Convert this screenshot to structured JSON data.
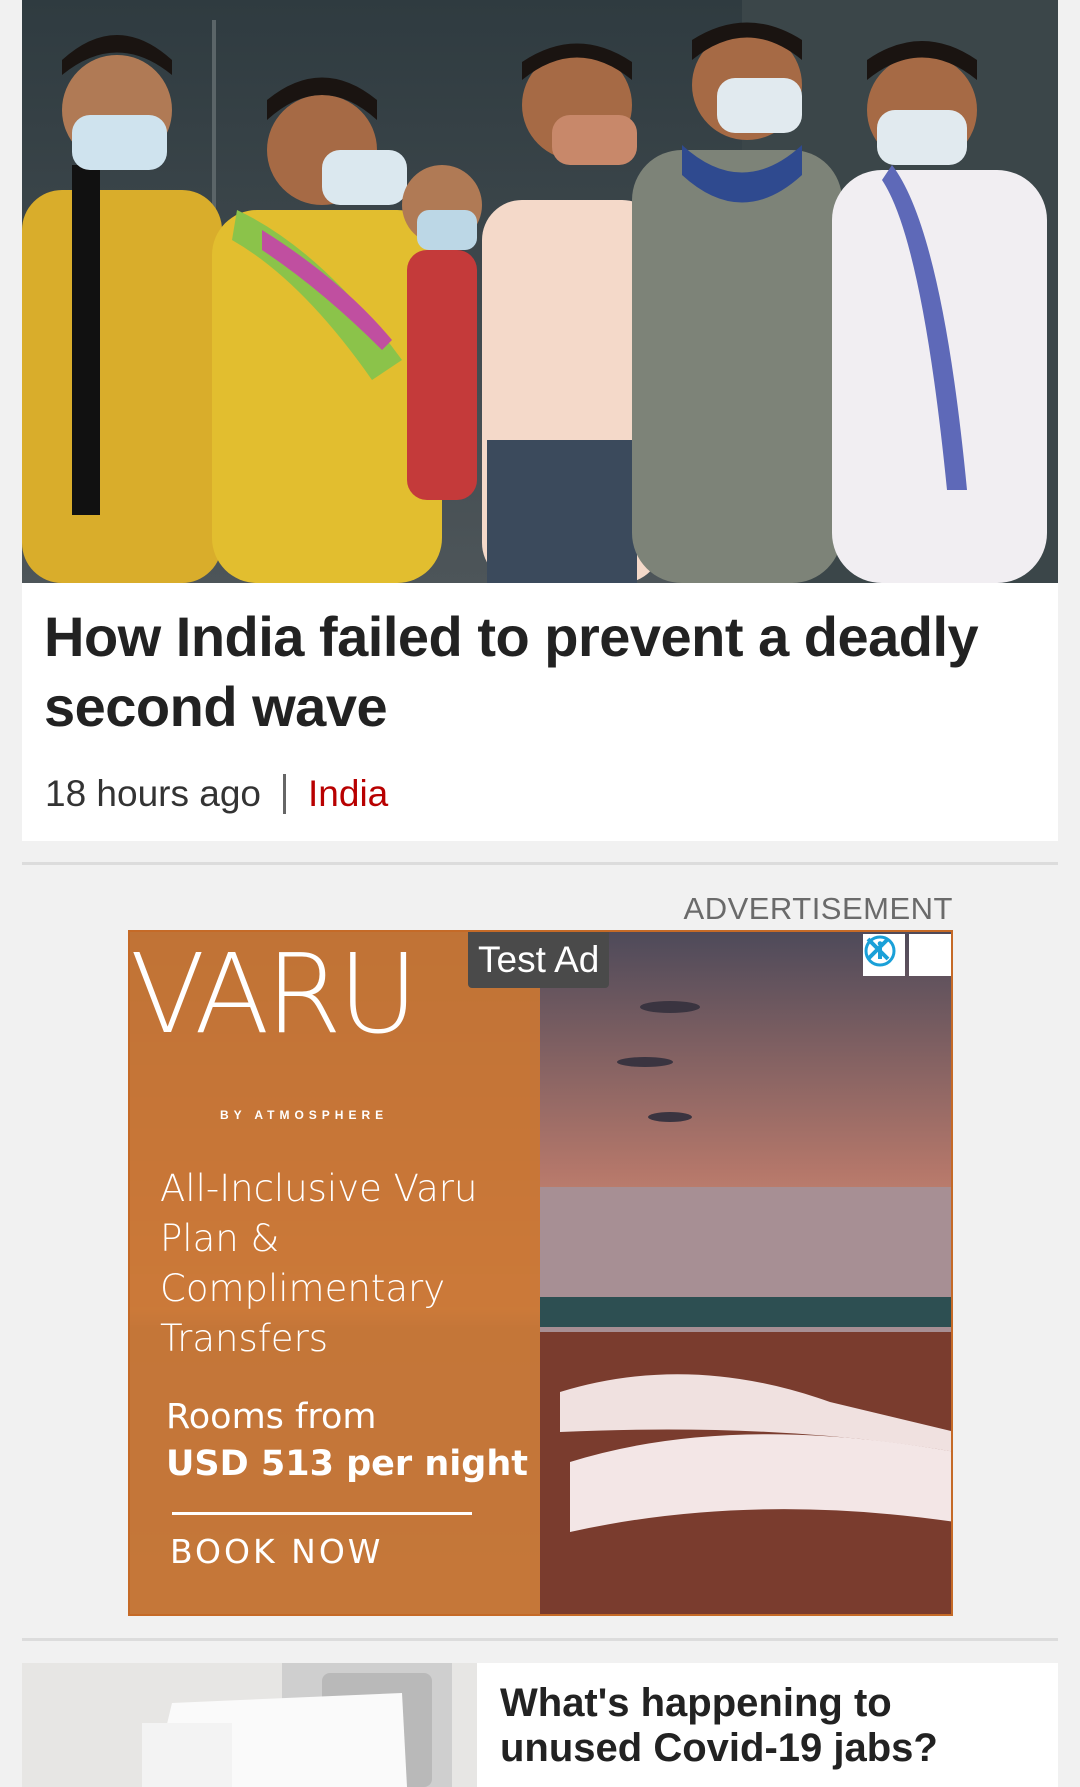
{
  "hero": {
    "image_alt": "Women in face masks and a child standing together, grieving",
    "title": "How India failed to prevent a deadly second wave",
    "time": "18 hours ago",
    "category": "India"
  },
  "ad": {
    "label": "ADVERTISEMENT",
    "test_badge": "Test Ad",
    "brand": "VARU",
    "brand_sub": "BY ATMOSPHERE",
    "offer": "All-Inclusive Varu Plan & Complimentary Transfers",
    "rooms": "Rooms from",
    "price": "USD 513 per night",
    "cta": "BOOK NOW",
    "info_icon": "info-icon",
    "close_icon": "close-icon",
    "panel_color": "#c97634"
  },
  "story": {
    "title": "What's happening to unused Covid-19 jabs?"
  },
  "colors": {
    "accent": "#b80000",
    "background": "#f1f1f1"
  }
}
